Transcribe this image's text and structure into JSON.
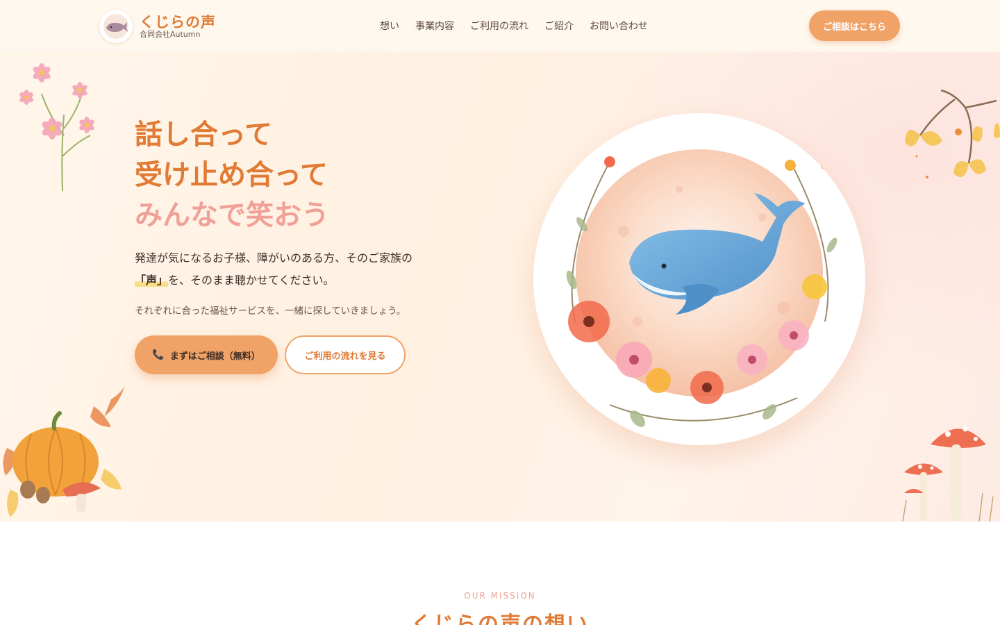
{
  "brand": {
    "name": "くじらの声",
    "company": "合同会社Autumn"
  },
  "nav": {
    "items": [
      "想い",
      "事業内容",
      "ご利用の流れ",
      "ご紹介",
      "お問い合わせ"
    ]
  },
  "header": {
    "cta_label": "ご相談はこちら"
  },
  "hero": {
    "headline_line1": "話し合って",
    "headline_line2": "受け止め合って",
    "headline_line3": "みんなで笑おう",
    "lead_line1": "発達が気になるお子様、障がいのある方、そのご家族の",
    "lead_quote": "「声」",
    "lead_line2_rest": "を、そのまま聴かせてください。",
    "sublead": "それぞれに合った福祉サービスを、一緒に探していきましょう。",
    "primary_button": "まずはご相談（無料）",
    "secondary_button": "ご利用の流れを見る"
  },
  "mission": {
    "eyebrow": "OUR MISSION",
    "title": "くじらの声の想い"
  },
  "colors": {
    "accent": "#e07a34",
    "button": "#f0a267",
    "pink": "#f0a096",
    "whale": "#6aa6d6"
  },
  "icons": [
    "whale-logo-icon",
    "phone-icon",
    "whale-illustration",
    "cosmos-flower-icon",
    "ginkgo-branch-icon",
    "pumpkin-icon",
    "mushroom-icon"
  ]
}
